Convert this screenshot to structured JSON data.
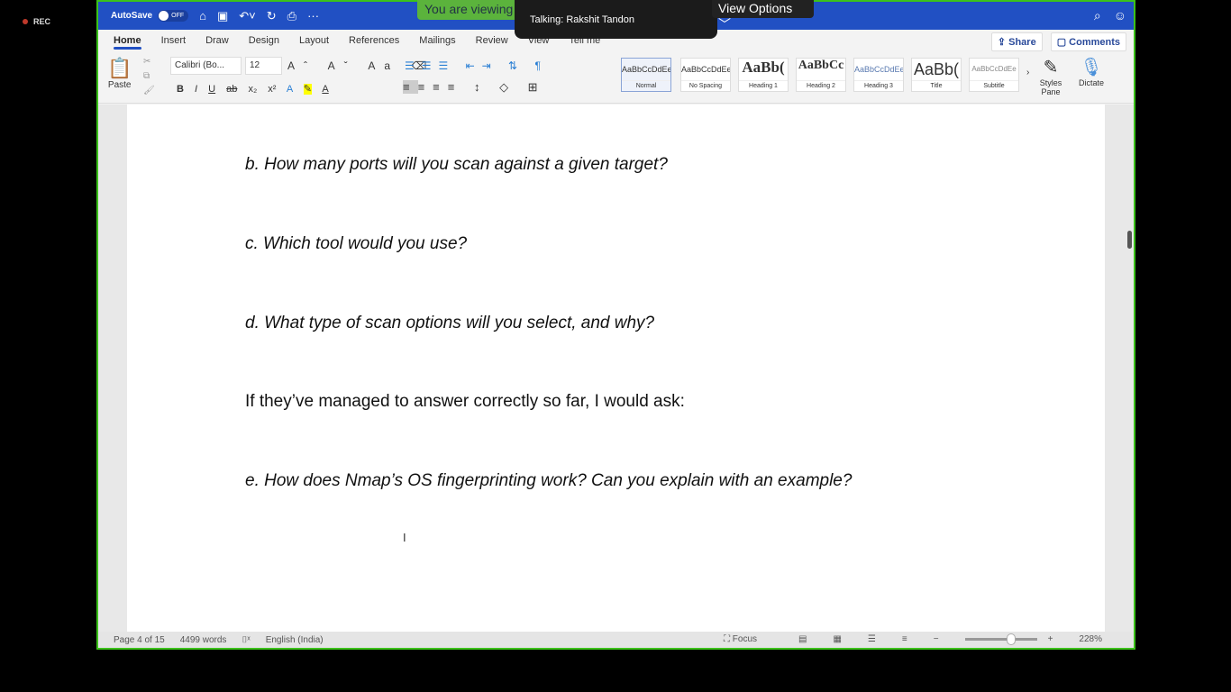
{
  "recording": {
    "label": "REC",
    "color": "#c0392b"
  },
  "titlebar": {
    "autosave": "AutoSave",
    "toggle": "OFF",
    "bg": "#2150c3"
  },
  "tabs": [
    "Home",
    "Insert",
    "Draw",
    "Design",
    "Layout",
    "References",
    "Mailings",
    "Review",
    "View",
    "Tell me"
  ],
  "share": "Share",
  "comments": "Comments",
  "ribbon": {
    "paste": "Paste",
    "font": "Calibri (Bo...",
    "size": "12",
    "styles_pane": "Styles Pane",
    "dictate": "Dictate",
    "styles": [
      {
        "preview": "AaBbCcDdEe",
        "name": "Normal"
      },
      {
        "preview": "AaBbCcDdEe",
        "name": "No Spacing"
      },
      {
        "preview": "AaBb(",
        "name": "Heading 1"
      },
      {
        "preview": "AaBbCc",
        "name": "Heading 2"
      },
      {
        "preview": "AaBbCcDdEe",
        "name": "Heading 3"
      },
      {
        "preview": "AaBb(",
        "name": "Title"
      },
      {
        "preview": "AaBbCcDdEe",
        "name": "Subtitle"
      }
    ]
  },
  "document": {
    "lines": [
      "b. How many ports will you scan against a given target?",
      "c. Which tool would you use?",
      "d. What type of scan options will you select, and why?",
      "If they’ve managed to answer correctly so far, I would ask:",
      "e. How does Nmap’s OS fingerprinting work? Can you explain with an example?"
    ]
  },
  "status": {
    "page": "Page 4 of 15",
    "words": "4499 words",
    "language": "English (India)",
    "focus": "Focus",
    "zoom": "228%",
    "zoom_slider_fraction": 0.6
  },
  "overlay": {
    "viewing": "You are viewing",
    "talking": "Talking: Rakshit Tandon",
    "view_options": "View Options ﹀"
  }
}
